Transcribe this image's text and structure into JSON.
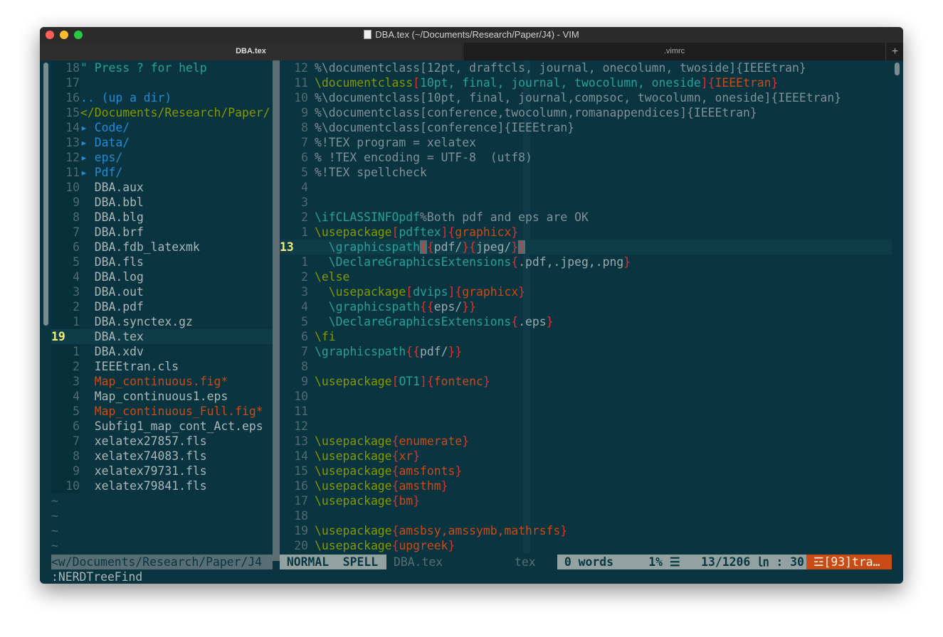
{
  "window": {
    "title": "DBA.tex (~/Documents/Research/Paper/J4) - VIM",
    "traffic_colors": [
      "#fe5f57",
      "#febc2e",
      "#28c840"
    ]
  },
  "tabs": [
    {
      "label": "DBA.tex",
      "active": true
    },
    {
      "label": ".vimrc",
      "active": false
    }
  ],
  "tab_add_label": "+",
  "tree": {
    "rows": [
      {
        "n": "18",
        "t": "\" Press ? for help",
        "c": "c-cy"
      },
      {
        "n": "17",
        "t": "",
        "c": ""
      },
      {
        "n": "16",
        "t": ".. (up a dir)",
        "c": "c-bl"
      },
      {
        "n": "15",
        "t": "</Documents/Research/Paper/",
        "c": "c-gr"
      },
      {
        "n": "14",
        "t": "▸ Code/",
        "c": "c-bl"
      },
      {
        "n": "13",
        "t": "▸ Data/",
        "c": "c-bl"
      },
      {
        "n": "12",
        "t": "▸ eps/",
        "c": "c-bl"
      },
      {
        "n": "11",
        "t": "▸ Pdf/",
        "c": "c-bl"
      },
      {
        "n": "10",
        "t": "  DBA.aux",
        "c": "c-fg"
      },
      {
        "n": "9",
        "t": "  DBA.bbl",
        "c": "c-fg"
      },
      {
        "n": "8",
        "t": "  DBA.blg",
        "c": "c-fg"
      },
      {
        "n": "7",
        "t": "  DBA.brf",
        "c": "c-fg"
      },
      {
        "n": "6",
        "t": "  DBA.fdb_latexmk",
        "c": "c-fg"
      },
      {
        "n": "5",
        "t": "  DBA.fls",
        "c": "c-fg"
      },
      {
        "n": "4",
        "t": "  DBA.log",
        "c": "c-fg"
      },
      {
        "n": "3",
        "t": "  DBA.out",
        "c": "c-fg"
      },
      {
        "n": "2",
        "t": "  DBA.pdf",
        "c": "c-fg"
      },
      {
        "n": "1",
        "t": "  DBA.synctex.gz",
        "c": "c-fg"
      },
      {
        "n": "19",
        "t": "  DBA.tex",
        "c": "c-fg",
        "current": true
      },
      {
        "n": "1",
        "t": "  DBA.xdv",
        "c": "c-fg"
      },
      {
        "n": "2",
        "t": "  IEEEtran.cls",
        "c": "c-fg"
      },
      {
        "n": "3",
        "t": "  Map_continuous.fig*",
        "c": "c-or"
      },
      {
        "n": "4",
        "t": "  Map_continuous1.eps",
        "c": "c-fg"
      },
      {
        "n": "5",
        "t": "  Map_continuous_Full.fig*",
        "c": "c-or"
      },
      {
        "n": "6",
        "t": "  Subfig1_map_cont_Act.eps",
        "c": "c-fg"
      },
      {
        "n": "7",
        "t": "  xelatex27857.fls",
        "c": "c-fg"
      },
      {
        "n": "8",
        "t": "  xelatex74083.fls",
        "c": "c-fg"
      },
      {
        "n": "9",
        "t": "  xelatex79731.fls",
        "c": "c-fg"
      },
      {
        "n": "10",
        "t": "  xelatex79841.fls",
        "c": "c-fg"
      }
    ],
    "tildes": [
      "~",
      "~",
      "~",
      "~"
    ]
  },
  "editor": {
    "lines": [
      {
        "n": "12",
        "s": [
          [
            "c-cm",
            "%\\documentclass[12pt, draftcls, journal, onecolumn, twoside]{IEEEtran}"
          ]
        ]
      },
      {
        "n": "11",
        "s": [
          [
            "c-gr",
            "\\documentclass"
          ],
          [
            "c-red",
            "["
          ],
          [
            "c-cy",
            "10pt, final, journal, twocolumn, oneside"
          ],
          [
            "c-red",
            "]{"
          ],
          [
            "c-or",
            "IEEEtran"
          ],
          [
            "c-red",
            "}"
          ]
        ]
      },
      {
        "n": "10",
        "s": [
          [
            "c-cm",
            "%\\documentclass[10pt, final, journal,compsoc, twocolumn, oneside]{IEEEtran}"
          ]
        ]
      },
      {
        "n": "9",
        "s": [
          [
            "c-cm",
            "%\\documentclass[conference,twocolumn,romanappendices]{IEEEtran}"
          ]
        ]
      },
      {
        "n": "8",
        "s": [
          [
            "c-cm",
            "%\\documentclass[conference]{IEEEtran}"
          ]
        ]
      },
      {
        "n": "7",
        "s": [
          [
            "c-cm",
            "%!TEX program = xelatex"
          ]
        ]
      },
      {
        "n": "6",
        "s": [
          [
            "c-cm",
            "% !TEX encoding = UTF-8  (utf8)"
          ]
        ]
      },
      {
        "n": "5",
        "s": [
          [
            "c-cm",
            "%!TEX spellcheck"
          ]
        ]
      },
      {
        "n": "4",
        "s": []
      },
      {
        "n": "3",
        "s": []
      },
      {
        "n": "2",
        "s": [
          [
            "c-tl",
            "\\ifCLASSINFOpdf"
          ],
          [
            "c-cm",
            "%Both pdf and eps are OK"
          ]
        ]
      },
      {
        "n": "1",
        "s": [
          [
            "c-gr",
            "\\usepackage"
          ],
          [
            "c-red",
            "["
          ],
          [
            "c-cy",
            "pdftex"
          ],
          [
            "c-red",
            "]{"
          ],
          [
            "c-or",
            "graphicx"
          ],
          [
            "c-red",
            "}"
          ]
        ]
      },
      {
        "n": "13",
        "current": true,
        "s": [
          [
            "c-tl",
            "  \\graphicspath"
          ],
          [
            "c-red c-hl",
            "{"
          ],
          [
            "c-red",
            "{"
          ],
          [
            "c-tx",
            "pdf/"
          ],
          [
            "c-red",
            "}{"
          ],
          [
            "c-tx",
            "jpeg/"
          ],
          [
            "c-red",
            "}"
          ],
          [
            "c-red c-hl",
            "}"
          ]
        ]
      },
      {
        "n": "1",
        "s": [
          [
            "c-tl",
            "  \\DeclareGraphicsExtensions"
          ],
          [
            "c-red",
            "{"
          ],
          [
            "c-tx",
            ".pdf,.jpeg,.png"
          ],
          [
            "c-red",
            "}"
          ]
        ]
      },
      {
        "n": "2",
        "s": [
          [
            "c-gr",
            "\\else"
          ]
        ]
      },
      {
        "n": "3",
        "s": [
          [
            "c-gr",
            "  \\usepackage"
          ],
          [
            "c-red",
            "["
          ],
          [
            "c-cy",
            "dvips"
          ],
          [
            "c-red",
            "]{"
          ],
          [
            "c-or",
            "graphicx"
          ],
          [
            "c-red",
            "}"
          ]
        ]
      },
      {
        "n": "4",
        "s": [
          [
            "c-tl",
            "  \\graphicspath"
          ],
          [
            "c-red",
            "{{"
          ],
          [
            "c-tx",
            "eps/"
          ],
          [
            "c-red",
            "}}"
          ]
        ]
      },
      {
        "n": "5",
        "s": [
          [
            "c-tl",
            "  \\DeclareGraphicsExtensions"
          ],
          [
            "c-red",
            "{"
          ],
          [
            "c-tx",
            ".eps"
          ],
          [
            "c-red",
            "}"
          ]
        ]
      },
      {
        "n": "6",
        "s": [
          [
            "c-gr",
            "\\fi"
          ]
        ]
      },
      {
        "n": "7",
        "s": [
          [
            "c-tl",
            "\\graphicspath"
          ],
          [
            "c-red",
            "{{"
          ],
          [
            "c-tx",
            "pdf/"
          ],
          [
            "c-red",
            "}}"
          ]
        ]
      },
      {
        "n": "8",
        "s": []
      },
      {
        "n": "9",
        "s": [
          [
            "c-gr",
            "\\usepackage"
          ],
          [
            "c-red",
            "["
          ],
          [
            "c-cy",
            "OT1"
          ],
          [
            "c-red",
            "]{"
          ],
          [
            "c-or",
            "fontenc"
          ],
          [
            "c-red",
            "}"
          ]
        ]
      },
      {
        "n": "10",
        "s": []
      },
      {
        "n": "11",
        "s": []
      },
      {
        "n": "12",
        "s": []
      },
      {
        "n": "13",
        "s": [
          [
            "c-gr",
            "\\usepackage"
          ],
          [
            "c-red",
            "{"
          ],
          [
            "c-or",
            "enumerate"
          ],
          [
            "c-red",
            "}"
          ]
        ]
      },
      {
        "n": "14",
        "s": [
          [
            "c-gr",
            "\\usepackage"
          ],
          [
            "c-red",
            "{"
          ],
          [
            "c-or",
            "xr"
          ],
          [
            "c-red",
            "}"
          ]
        ]
      },
      {
        "n": "15",
        "s": [
          [
            "c-gr",
            "\\usepackage"
          ],
          [
            "c-red",
            "{"
          ],
          [
            "c-or",
            "amsfonts"
          ],
          [
            "c-red",
            "}"
          ]
        ]
      },
      {
        "n": "16",
        "s": [
          [
            "c-gr",
            "\\usepackage"
          ],
          [
            "c-red",
            "{"
          ],
          [
            "c-or",
            "amsthm"
          ],
          [
            "c-red",
            "}"
          ]
        ]
      },
      {
        "n": "17",
        "s": [
          [
            "c-gr",
            "\\usepackage"
          ],
          [
            "c-red",
            "{"
          ],
          [
            "c-or",
            "bm"
          ],
          [
            "c-red",
            "}"
          ]
        ]
      },
      {
        "n": "18",
        "s": []
      },
      {
        "n": "19",
        "s": [
          [
            "c-gr",
            "\\usepackage"
          ],
          [
            "c-red",
            "{"
          ],
          [
            "c-or",
            "amsbsy,amssymb,mathrsfs"
          ],
          [
            "c-red",
            "}"
          ]
        ]
      },
      {
        "n": "20",
        "s": [
          [
            "c-gr",
            "\\usepackage"
          ],
          [
            "c-red",
            "{"
          ],
          [
            "c-or",
            "upgreek"
          ],
          [
            "c-red",
            "}"
          ]
        ]
      }
    ]
  },
  "statusline": {
    "tree_path": "<w/Documents/Research/Paper/J4",
    "mode": " NORMAL  SPELL",
    "file": "DBA.tex",
    "filetype": "tex",
    "info": " 0 words     1% ☰   13/1206 ㏑ : 30",
    "warning": " ☲[93]tra…"
  },
  "cmdline": ":NERDTreeFind"
}
